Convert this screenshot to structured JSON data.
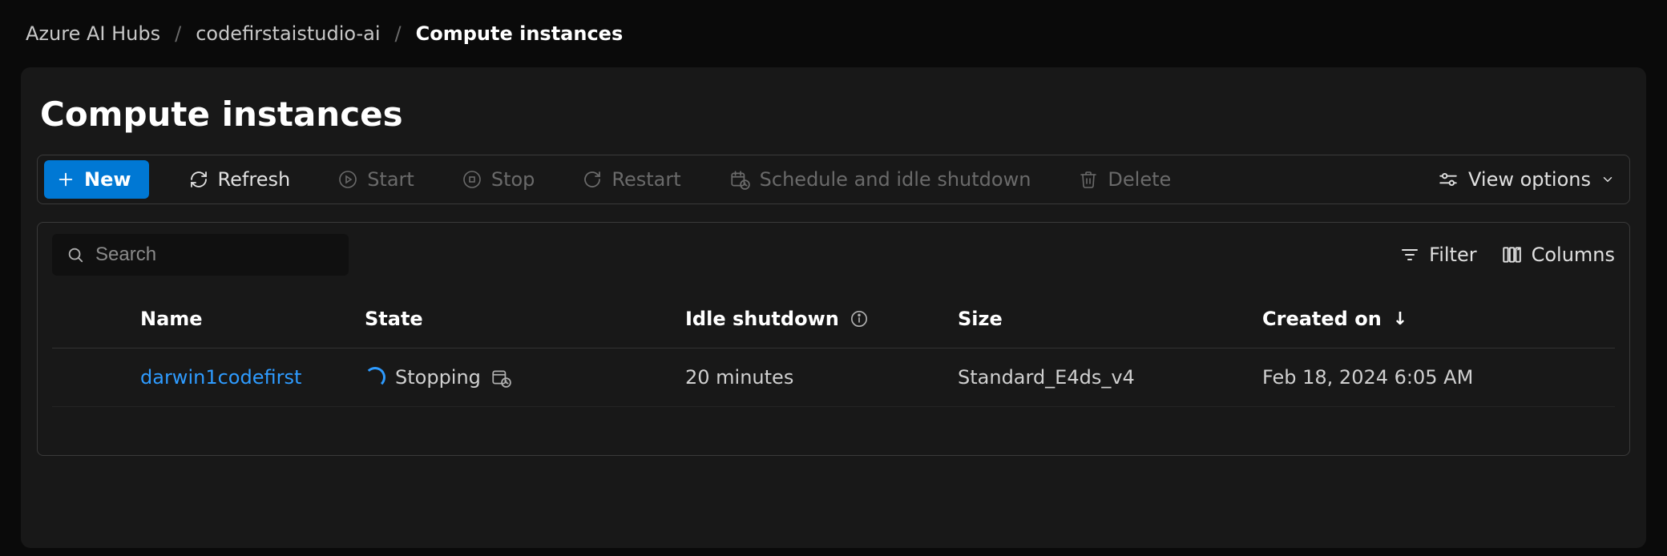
{
  "breadcrumb": {
    "items": [
      "Azure AI Hubs",
      "codefirstaistudio-ai"
    ],
    "current": "Compute instances"
  },
  "page": {
    "title": "Compute instances"
  },
  "toolbar": {
    "new_label": "New",
    "refresh_label": "Refresh",
    "start_label": "Start",
    "stop_label": "Stop",
    "restart_label": "Restart",
    "schedule_label": "Schedule and idle shutdown",
    "delete_label": "Delete",
    "view_options_label": "View options"
  },
  "controls": {
    "search_placeholder": "Search",
    "filter_label": "Filter",
    "columns_label": "Columns"
  },
  "table": {
    "headers": {
      "name": "Name",
      "state": "State",
      "idle": "Idle shutdown",
      "size": "Size",
      "created": "Created on"
    },
    "rows": [
      {
        "name": "darwin1codefirst",
        "state": "Stopping",
        "idle": "20 minutes",
        "size": "Standard_E4ds_v4",
        "created": "Feb 18, 2024 6:05 AM"
      }
    ]
  }
}
